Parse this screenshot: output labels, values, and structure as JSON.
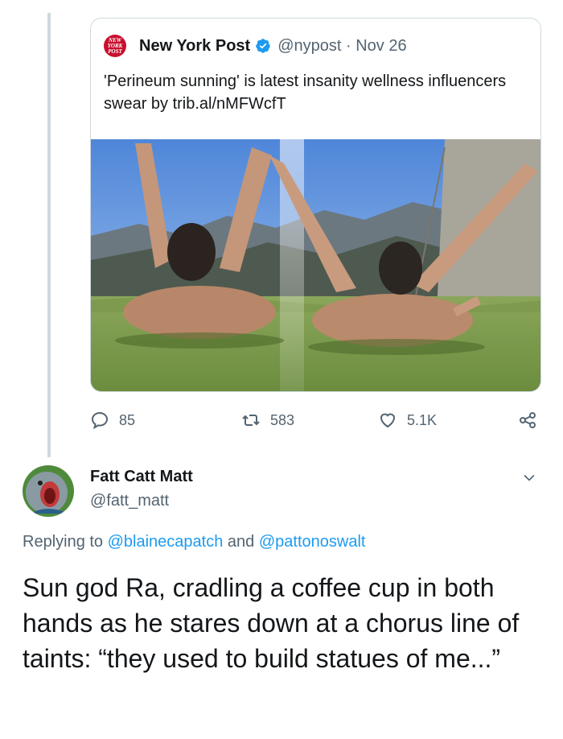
{
  "quoted_tweet": {
    "author_name": "New York Post",
    "logo_text": "NEW YORK POST",
    "handle": "@nypost",
    "separator": "·",
    "date": "Nov 26",
    "text": "'Perineum sunning' is latest insanity wellness influencers swear by trib.al/nMFWcfT",
    "media_icon": "photo"
  },
  "actions": {
    "replies": "85",
    "retweets": "583",
    "likes": "5.1K",
    "reply_icon": "reply-icon",
    "retweet_icon": "retweet-icon",
    "like_icon": "heart-icon",
    "share_icon": "share-icon"
  },
  "reply_tweet": {
    "author_name": "Fatt Catt Matt",
    "handle": "@fatt_matt",
    "replying_prefix": "Replying to",
    "mention_1": "@blainecapatch",
    "replying_and": "and",
    "mention_2": "@pattonoswalt",
    "text": "Sun god Ra, cradling a coffee cup in both hands as he stares down at a chorus line of taints: “they used to build statues of me...”"
  },
  "colors": {
    "accent": "#1d9bf0",
    "secondary_text": "#536471",
    "brand_red": "#c8102e"
  }
}
